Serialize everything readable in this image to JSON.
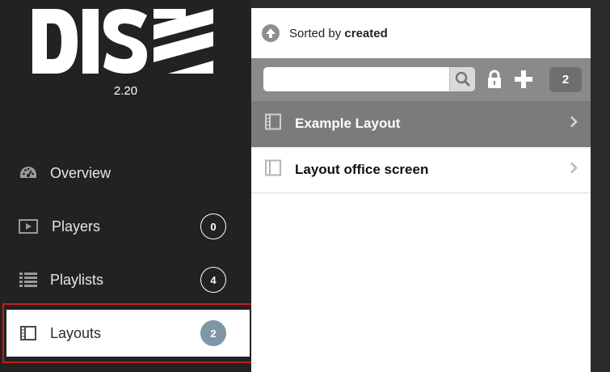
{
  "app": {
    "logo_text": "DISE",
    "version": "2.20"
  },
  "sidebar": {
    "items": [
      {
        "label": "Overview",
        "icon": "dashboard-icon",
        "count": null
      },
      {
        "label": "Players",
        "icon": "play-icon",
        "count": "0"
      },
      {
        "label": "Playlists",
        "icon": "list-icon",
        "count": "4"
      },
      {
        "label": "Layouts",
        "icon": "layout-icon",
        "count": "2",
        "active": true
      }
    ]
  },
  "panel": {
    "sort": {
      "prefix": "Sorted by",
      "field": "created"
    },
    "search": {
      "value": "",
      "placeholder": ""
    },
    "total_count": "2",
    "layouts": [
      {
        "name": "Example Layout",
        "selected": true
      },
      {
        "name": "Layout office screen",
        "selected": false
      }
    ]
  },
  "colors": {
    "sidebar_bg": "#222222",
    "active_badge": "#7f96a6",
    "highlight_outline": "#c01f1f",
    "selected_row": "#7b7b7b",
    "toolbar_bg": "#8a8a8a"
  }
}
